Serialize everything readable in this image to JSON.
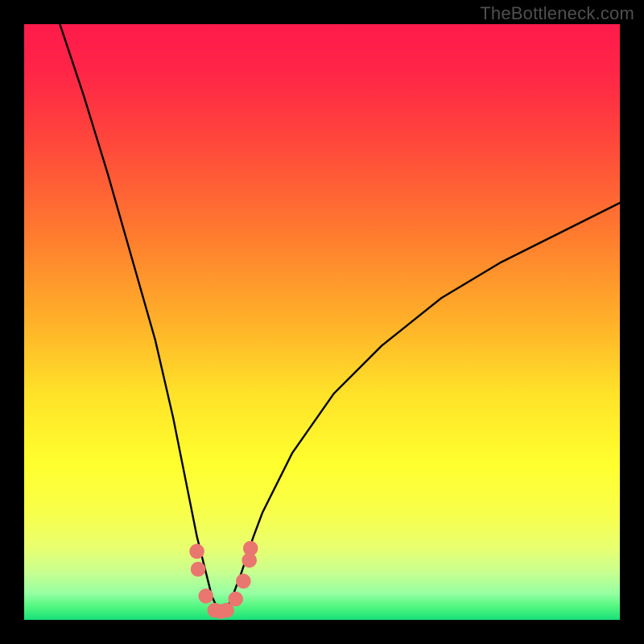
{
  "watermark": "TheBottleneck.com",
  "chart_data": {
    "type": "line",
    "title": "",
    "xlabel": "",
    "ylabel": "",
    "xlim": [
      0,
      100
    ],
    "ylim": [
      0,
      100
    ],
    "grid": false,
    "legend": "none",
    "gradient_stops": [
      {
        "offset": 0.0,
        "color": "#ff1b4b"
      },
      {
        "offset": 0.08,
        "color": "#ff2547"
      },
      {
        "offset": 0.2,
        "color": "#ff483b"
      },
      {
        "offset": 0.35,
        "color": "#ff7a2f"
      },
      {
        "offset": 0.5,
        "color": "#ffb129"
      },
      {
        "offset": 0.62,
        "color": "#ffe229"
      },
      {
        "offset": 0.74,
        "color": "#ffff2e"
      },
      {
        "offset": 0.82,
        "color": "#f8ff4a"
      },
      {
        "offset": 0.88,
        "color": "#e8ff70"
      },
      {
        "offset": 0.92,
        "color": "#c8ff90"
      },
      {
        "offset": 0.955,
        "color": "#96ffa2"
      },
      {
        "offset": 0.98,
        "color": "#4cf57e"
      },
      {
        "offset": 1.0,
        "color": "#18e07b"
      }
    ],
    "series": [
      {
        "name": "bottleneck-curve",
        "color": "#000000",
        "x": [
          6,
          10,
          14,
          18,
          22,
          25,
          27,
          29,
          30.5,
          31.5,
          32.5,
          33,
          33.5,
          34,
          35,
          36.5,
          38.5,
          40,
          45,
          52,
          60,
          70,
          80,
          90,
          100
        ],
        "values": [
          100,
          88,
          75,
          61,
          47,
          34,
          24,
          14,
          8,
          4,
          1.8,
          1.4,
          1.4,
          1.8,
          4,
          8,
          14,
          18,
          28,
          38,
          46,
          54,
          60,
          65,
          70
        ]
      }
    ],
    "markers": {
      "name": "highlight-dots",
      "color": "#e9766f",
      "radius_percent": 1.25,
      "points": [
        {
          "x": 29.0,
          "y": 11.5
        },
        {
          "x": 29.2,
          "y": 8.5
        },
        {
          "x": 30.5,
          "y": 4.0
        },
        {
          "x": 32.0,
          "y": 1.6
        },
        {
          "x": 33.0,
          "y": 1.4
        },
        {
          "x": 34.0,
          "y": 1.6
        },
        {
          "x": 35.5,
          "y": 3.5
        },
        {
          "x": 36.8,
          "y": 6.5
        },
        {
          "x": 37.8,
          "y": 10.0
        },
        {
          "x": 38.0,
          "y": 12.0
        }
      ]
    }
  }
}
